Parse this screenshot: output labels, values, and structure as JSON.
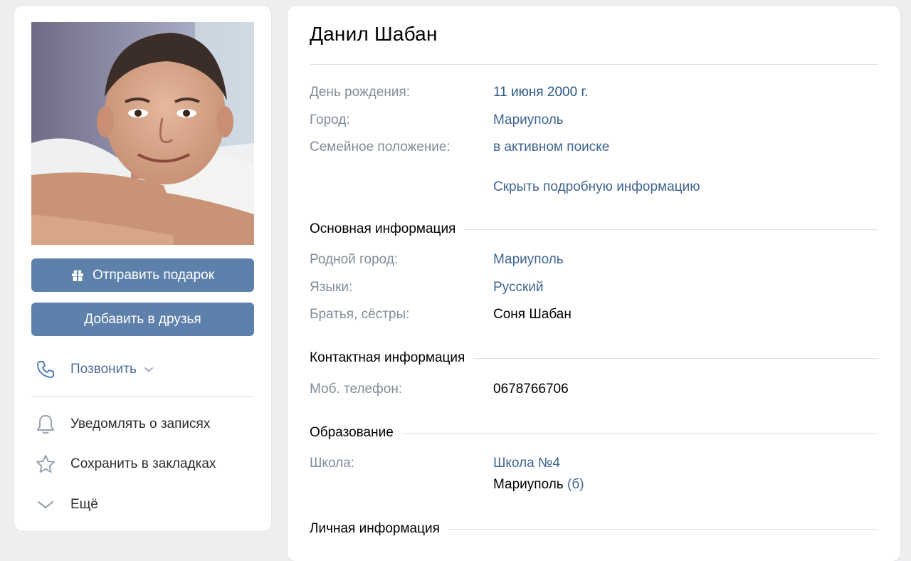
{
  "profile": {
    "name": "Данил Шабан",
    "photo_alt": "profile-photo"
  },
  "actions": {
    "send_gift": "Отправить подарок",
    "add_friend": "Добавить в друзья",
    "call": "Позвонить",
    "notify": "Уведомлять о записях",
    "bookmark": "Сохранить в закладках",
    "more": "Ещё"
  },
  "short_info": [
    {
      "label": "День рождения:",
      "value": "11 июня 2000 г."
    },
    {
      "label": "Город:",
      "value": "Мариуполь"
    },
    {
      "label": "Семейное положение:",
      "value": "в активном поиске"
    }
  ],
  "hide_details": "Скрыть подробную информацию",
  "basic": {
    "title": "Основная информация",
    "rows": [
      {
        "label": "Родной город:",
        "value": "Мариуполь"
      },
      {
        "label": "Языки:",
        "value": "Русский"
      },
      {
        "label": "Братья, сёстры:",
        "value": "Соня Шабан"
      }
    ]
  },
  "contact": {
    "title": "Контактная информация",
    "rows": [
      {
        "label": "Моб. телефон:",
        "value": "0678766706"
      }
    ]
  },
  "education": {
    "title": "Образование",
    "rows": [
      {
        "label": "Школа:",
        "value": "Школа №4"
      }
    ],
    "school_city": "Мариуполь",
    "school_class": "(б)"
  },
  "personal": {
    "title": "Личная информация"
  },
  "colors": {
    "background": "#edeef0",
    "button": "#5e81ac",
    "link": "#3f6592",
    "label": "#818c99"
  }
}
